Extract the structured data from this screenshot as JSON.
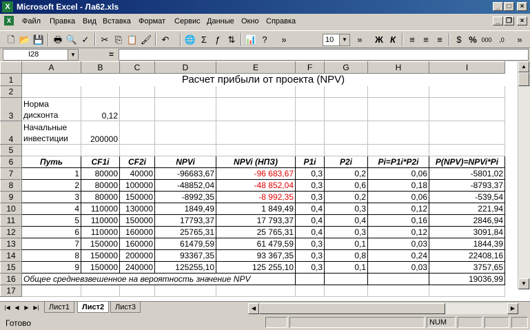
{
  "window": {
    "title": "Microsoft Excel - Ла62.xls",
    "btn_min": "_",
    "btn_max": "□",
    "btn_close": "×",
    "doc_btn_min": "_",
    "doc_btn_max": "❐",
    "doc_btn_close": "×"
  },
  "menu": [
    "Файл",
    "Правка",
    "Вид",
    "Вставка",
    "Формат",
    "Сервис",
    "Данные",
    "Окно",
    "Справка"
  ],
  "toolbar": {
    "icons": [
      "new-icon",
      "open-icon",
      "save-icon",
      "print-icon",
      "print-preview-icon",
      "spelling-icon",
      "cut-icon",
      "copy-icon",
      "paste-icon",
      "format-painter-icon",
      "undo-icon",
      "hyperlink-icon",
      "autosum-icon",
      "function-icon",
      "sort-icon",
      "chart-wizard-icon",
      "help-icon"
    ],
    "font_size": "10",
    "bold": "Ж",
    "italic": "К",
    "percent": "%",
    "thousands": "000"
  },
  "formula_bar": {
    "name_box": "I28",
    "equals": "=",
    "value": ""
  },
  "columns": [
    "A",
    "B",
    "C",
    "D",
    "E",
    "F",
    "G",
    "H",
    "I"
  ],
  "rows": [
    {
      "num": "1",
      "title": "Расчет прибыли от проекта (NPV)"
    },
    {
      "num": "2"
    },
    {
      "num": "3",
      "a1": "Норма",
      "a2": "дисконта",
      "b": "0,12"
    },
    {
      "num": "4",
      "a1": "Начальные",
      "a2": "инвестиции",
      "b": "200000"
    },
    {
      "num": "5"
    },
    {
      "num": "6",
      "header": [
        "Путь",
        "CF1i",
        "CF2i",
        "NPVi",
        "NPVi (НПЗ)",
        "P1i",
        "P2i",
        "Pi=P1i*P2i",
        "P(NPV)=NPVi*Pi"
      ]
    },
    {
      "num": "7",
      "cells": [
        "1",
        "80000",
        "40000",
        "-96683,67",
        "-96 683,67",
        "0,3",
        "0,2",
        "0,06",
        "-5801,02"
      ],
      "red": true
    },
    {
      "num": "8",
      "cells": [
        "2",
        "80000",
        "100000",
        "-48852,04",
        "-48 852,04",
        "0,3",
        "0,6",
        "0,18",
        "-8793,37"
      ],
      "red": true
    },
    {
      "num": "9",
      "cells": [
        "3",
        "80000",
        "150000",
        "-8992,35",
        "-8 992,35",
        "0,3",
        "0,2",
        "0,06",
        "-539,54"
      ],
      "red": true
    },
    {
      "num": "10",
      "cells": [
        "4",
        "110000",
        "130000",
        "1849,49",
        "1 849,49",
        "0,4",
        "0,3",
        "0,12",
        "221,94"
      ]
    },
    {
      "num": "11",
      "cells": [
        "5",
        "110000",
        "150000",
        "17793,37",
        "17 793,37",
        "0,4",
        "0,4",
        "0,16",
        "2846,94"
      ]
    },
    {
      "num": "12",
      "cells": [
        "6",
        "110000",
        "160000",
        "25765,31",
        "25 765,31",
        "0,4",
        "0,3",
        "0,12",
        "3091,84"
      ]
    },
    {
      "num": "13",
      "cells": [
        "7",
        "150000",
        "160000",
        "61479,59",
        "61 479,59",
        "0,3",
        "0,1",
        "0,03",
        "1844,39"
      ]
    },
    {
      "num": "14",
      "cells": [
        "8",
        "150000",
        "200000",
        "93367,35",
        "93 367,35",
        "0,3",
        "0,8",
        "0,24",
        "22408,16"
      ]
    },
    {
      "num": "15",
      "cells": [
        "9",
        "150000",
        "240000",
        "125255,10",
        "125 255,10",
        "0,3",
        "0,1",
        "0,03",
        "3757,65"
      ]
    },
    {
      "num": "16",
      "summary": "Общее средневзвешенное на вероятность значение NPV",
      "total": "19036,99"
    },
    {
      "num": "17"
    }
  ],
  "sheet_tabs": [
    "Лист1",
    "Лист2",
    "Лист3"
  ],
  "active_tab": "Лист2",
  "status": {
    "ready": "Готово",
    "num": "NUM"
  }
}
